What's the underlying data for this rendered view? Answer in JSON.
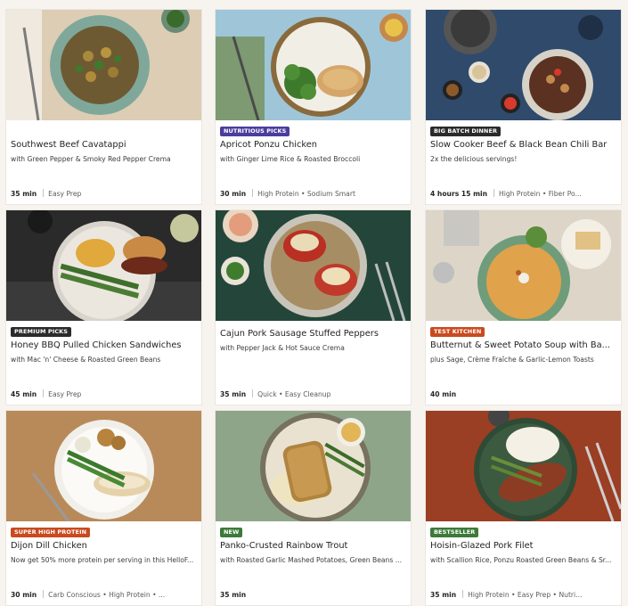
{
  "colors": {
    "badge_purple": "#4b3d9e",
    "badge_dark": "#2b2b2b",
    "badge_orange": "#c94a1e",
    "badge_green": "#3c7a3a",
    "badge_blue": "#2d5d8c"
  },
  "cards": [
    {
      "badge": "",
      "title": "Southwest Beef Cavatappi",
      "subtitle": "with Green Pepper & Smoky Red Pepper Crema",
      "time": "35 min",
      "tags": "Easy Prep"
    },
    {
      "badge": "NUTRITIOUS PICKS",
      "badge_color": "#4b3d9e",
      "title": "Apricot Ponzu Chicken",
      "subtitle": "with Ginger Lime Rice & Roasted Broccoli",
      "time": "30 min",
      "tags": "High Protein • Sodium Smart"
    },
    {
      "badge": "BIG BATCH DINNER",
      "badge_color": "#2b2b2b",
      "title": "Slow Cooker Beef & Black Bean Chili Bar",
      "subtitle": "2x the delicious servings!",
      "time": "4 hours 15 min",
      "tags": "High Protein • Fiber Po..."
    },
    {
      "badge": "PREMIUM PICKS",
      "badge_color": "#2b2b2b",
      "title": "Honey BBQ Pulled Chicken Sandwiches",
      "subtitle": "with Mac 'n' Cheese & Roasted Green Beans",
      "time": "45 min",
      "tags": "Easy Prep"
    },
    {
      "badge": "",
      "title": "Cajun Pork Sausage Stuffed Peppers",
      "subtitle": "with Pepper Jack & Hot Sauce Crema",
      "time": "35 min",
      "tags": "Quick • Easy Cleanup"
    },
    {
      "badge": "TEST KITCHEN",
      "badge_color": "#c94a1e",
      "title": "Butternut & Sweet Potato Soup with Ba...",
      "subtitle": "plus Sage, Crème Fraîche & Garlic-Lemon Toasts",
      "time": "40 min",
      "tags": ""
    },
    {
      "badge": "SUPER HIGH PROTEIN",
      "badge_color": "#c94a1e",
      "title": "Dijon Dill Chicken",
      "subtitle": "Now get 50% more protein per serving in this HelloF...",
      "time": "30 min",
      "tags": "Carb Conscious • High Protein • ..."
    },
    {
      "badge": "NEW",
      "badge_color": "#3c7a3a",
      "title": "Panko-Crusted Rainbow Trout",
      "subtitle": "with Roasted Garlic Mashed Potatoes, Green Beans ...",
      "time": "35 min",
      "tags": ""
    },
    {
      "badge": "BESTSELLER",
      "badge_color": "#3c7a3a",
      "title": "Hoisin-Glazed Pork Filet",
      "subtitle": "with Scallion Rice, Ponzu Roasted Green Beans & Sr...",
      "time": "35 min",
      "tags": "High Protein • Easy Prep • Nutri..."
    }
  ]
}
